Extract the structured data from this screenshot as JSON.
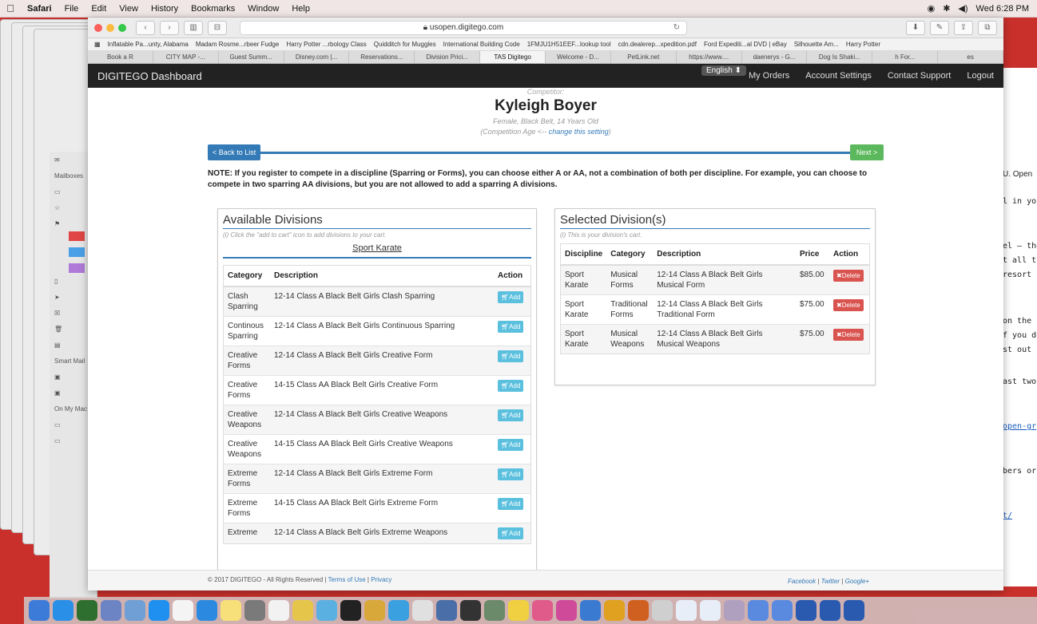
{
  "menubar": {
    "app": "Safari",
    "items": [
      "File",
      "Edit",
      "View",
      "History",
      "Bookmarks",
      "Window",
      "Help"
    ],
    "clock": "Wed 6:28 PM"
  },
  "browser": {
    "url": "usopen.digitego.com",
    "bookmarks": [
      "Inflatable Pa...unty, Alabama",
      "Madam Rosme...rbeer Fudge",
      "Harry Potter ...rbology Class",
      "Quidditch for Muggles",
      "International Building Code",
      "1FMJU1H51EEF...lookup tool",
      "cdn.dealerep...xpedition.pdf",
      "Ford Expediti...al DVD | eBay",
      "Silhouette Am...",
      "Harry Potter"
    ],
    "tabs": [
      "Book a R",
      "CITY MAP -...",
      "Guest Summ...",
      "Disney.com |...",
      "Reservations...",
      "Division Prici...",
      "TAS Digitego",
      "Welcome - D...",
      "PetLink.net",
      "https://www....",
      "daenerys - G...",
      "Dog Is Shaki...",
      "h For...",
      "es"
    ],
    "active_tab": "TAS Digitego"
  },
  "navbar": {
    "brand": "DIGITEGO Dashboard",
    "language": "English",
    "links": [
      "My Orders",
      "Account Settings",
      "Contact Support",
      "Logout"
    ]
  },
  "competitor": {
    "label": "Competitor:",
    "name": "Kyleigh Boyer",
    "details": "Female, Black Belt, 14 Years Old",
    "age_note_prefix": "(Competition Age <-- ",
    "age_note_link": "change this setting",
    "age_note_suffix": ")"
  },
  "nav_buttons": {
    "back": "< Back to List",
    "next": "Next >"
  },
  "note": "NOTE: If you register to compete in a discipline (Sparring or Forms), you can choose either A or AA, not a combination of both per discipline. For example, you can choose to compete in two sparring AA divisions, but you are not allowed to add a sparring A divisions.",
  "available": {
    "title": "Available Divisions",
    "hint": "(i) Click the \"add to cart\" icon to add divisions to your cart.",
    "tab": "Sport Karate",
    "headers": {
      "category": "Category",
      "description": "Description",
      "action": "Action"
    },
    "add_label": "Add",
    "rows": [
      {
        "category": "Clash Sparring",
        "description": "12-14 Class A Black Belt Girls Clash Sparring"
      },
      {
        "category": "Continous Sparring",
        "description": "12-14 Class A Black Belt Girls Continuous Sparring"
      },
      {
        "category": "Creative Forms",
        "description": "12-14 Class A Black Belt Girls Creative Form"
      },
      {
        "category": "Creative Forms",
        "description": "14-15 Class AA Black Belt Girls Creative Form"
      },
      {
        "category": "Creative Weapons",
        "description": "12-14 Class A Black Belt Girls Creative Weapons"
      },
      {
        "category": "Creative Weapons",
        "description": "14-15 Class AA Black Belt Girls Creative Weapons"
      },
      {
        "category": "Extreme Forms",
        "description": "12-14 Class A Black Belt Girls Extreme Form"
      },
      {
        "category": "Extreme Forms",
        "description": "14-15 Class AA Black Belt Girls Extreme Form"
      },
      {
        "category": "Extreme",
        "description": "12-14 Class A Black Belt Girls Extreme Weapons"
      }
    ]
  },
  "selected": {
    "title": "Selected Division(s)",
    "hint": "(i) This is your division's cart.",
    "headers": {
      "discipline": "Discipline",
      "category": "Category",
      "description": "Description",
      "price": "Price",
      "action": "Action"
    },
    "delete_label": "Delete",
    "rows": [
      {
        "discipline": "Sport Karate",
        "category": "Musical Forms",
        "description": "12-14 Class A Black Belt Girls Musical Form",
        "price": "$85.00"
      },
      {
        "discipline": "Sport Karate",
        "category": "Traditional Forms",
        "description": "12-14 Class A Black Belt Girls Traditional Form",
        "price": "$75.00"
      },
      {
        "discipline": "Sport Karate",
        "category": "Musical Weapons",
        "description": "12-14 Class A Black Belt Girls Musical Weapons",
        "price": "$75.00"
      }
    ]
  },
  "footer": {
    "copyright": "© 2017 DIGITEGO - All Rights Reserved | ",
    "terms": "Terms of Use",
    "sep": " | ",
    "privacy": "Privacy",
    "social": [
      "Facebook",
      "Twitter",
      "Google+"
    ]
  },
  "mail_sidebar": {
    "mailbox_label": "Mailboxes",
    "smart_label": "Smart Mail",
    "onmymac_label": "On My Mac"
  },
  "right_doc": {
    "title": "U. Open",
    "lines": [
      "l in you",
      "el – the",
      "t all the",
      "resort c",
      "on the",
      "f you do",
      "st out",
      "ast two",
      "open-gr",
      "bers or",
      "t/"
    ]
  },
  "colors": {
    "primary": "#337ab7",
    "success": "#5cb85c",
    "info": "#5bc0de",
    "danger": "#d9534f",
    "navbar": "#222222",
    "desktop": "#c9302c"
  }
}
